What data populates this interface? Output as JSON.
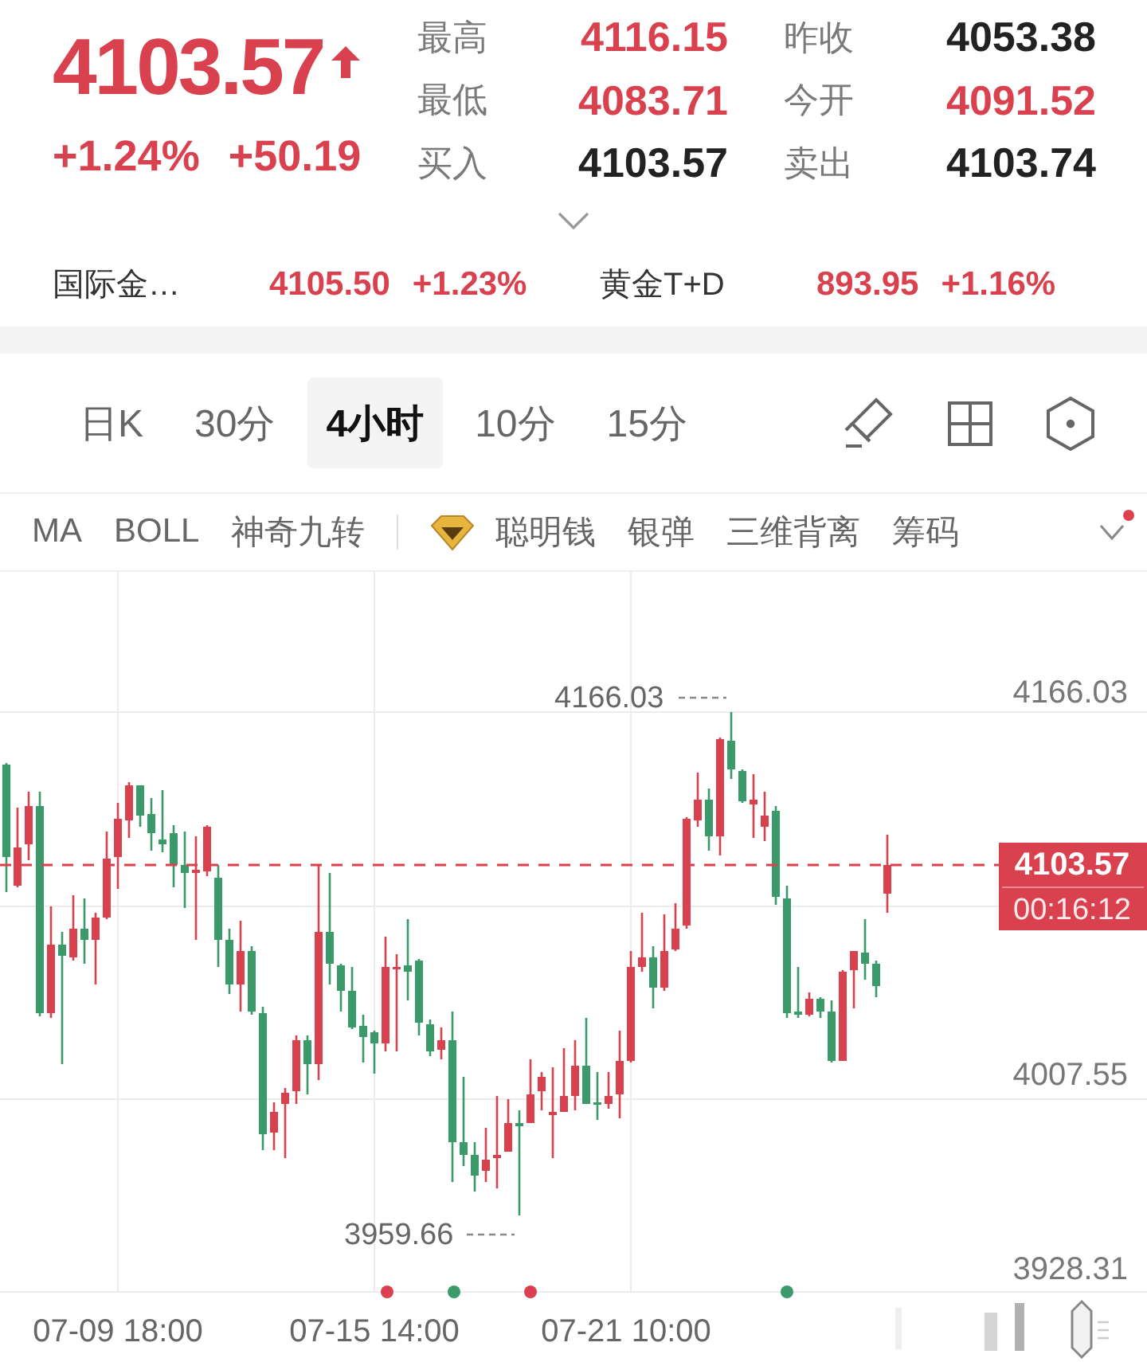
{
  "quote": {
    "price": "4103.57",
    "rising": true,
    "change_percent": "+1.24%",
    "change": "+50.19",
    "stats": [
      {
        "label": "最高",
        "value": "4116.15",
        "rising": true
      },
      {
        "label": "昨收",
        "value": "4053.38",
        "rising": false
      },
      {
        "label": "最低",
        "value": "4083.71",
        "rising": true
      },
      {
        "label": "今开",
        "value": "4091.52",
        "rising": true
      },
      {
        "label": "买入",
        "value": "4103.57",
        "rising": false
      },
      {
        "label": "卖出",
        "value": "4103.74",
        "rising": false
      }
    ]
  },
  "related": [
    {
      "name": "国际金…",
      "price": "4105.50",
      "change": "+1.23%",
      "rising": true
    },
    {
      "name": "黄金T+D",
      "price": "893.95",
      "change": "+1.16%",
      "rising": true
    }
  ],
  "period_tabs": [
    {
      "label": "日K",
      "selected": false
    },
    {
      "label": "30分",
      "selected": false
    },
    {
      "label": "4小时",
      "selected": true
    },
    {
      "label": "10分",
      "selected": false
    },
    {
      "label": "15分",
      "selected": false
    }
  ],
  "indicators": {
    "basic": [
      {
        "label": "MA"
      },
      {
        "label": "BOLL"
      },
      {
        "label": "神奇九转"
      }
    ],
    "advanced": [
      {
        "label": "聪明钱",
        "kind": "featured"
      },
      {
        "label": "银弹",
        "kind": "plain"
      },
      {
        "label": "三维背离",
        "kind": "plain"
      },
      {
        "label": "筹码",
        "kind": "plain"
      }
    ],
    "menu": {
      "notification": true
    }
  },
  "chart": {
    "price_axis": [
      "4166.03",
      "4007.55",
      "3928.31"
    ],
    "high_label": "4166.03",
    "low_label": "3959.66",
    "current_price": "4103.57",
    "countdown": "00:16:12",
    "time_axis": [
      "07-09 18:00",
      "07-15 14:00",
      "07-21 10:00"
    ],
    "markers": [
      {
        "color": "#d9414e"
      },
      {
        "color": "#3a9a6a"
      },
      {
        "color": "#d9414e"
      },
      {
        "color": "#3a9a6a"
      }
    ]
  }
}
